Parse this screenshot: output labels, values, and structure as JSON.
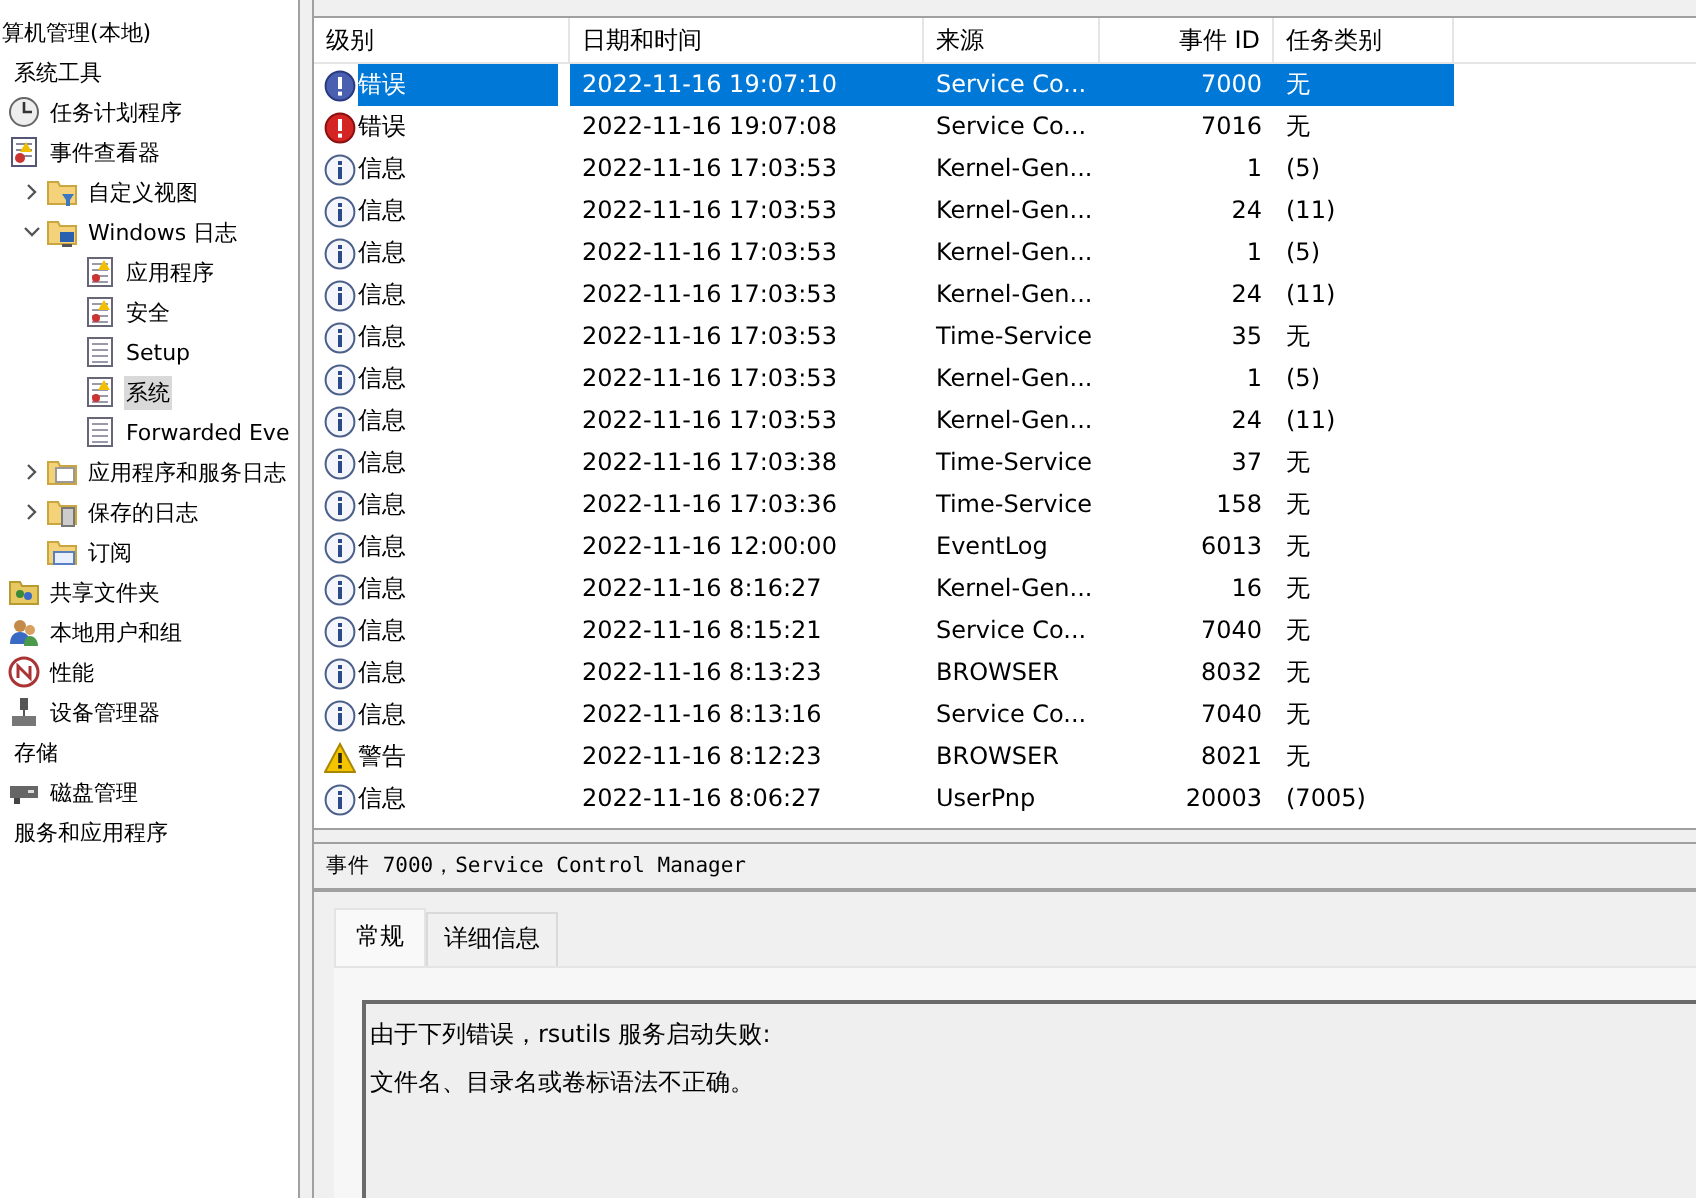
{
  "tree": {
    "label": "算机管理(本地)",
    "children": [
      {
        "label": "系统工具",
        "children": [
          {
            "label": "任务计划程序",
            "kind": "clock"
          },
          {
            "label": "事件查看器",
            "kind": "viewer",
            "children": [
              {
                "label": "自定义视图",
                "kind": "folder-filter",
                "expanded": false
              },
              {
                "label": "Windows 日志",
                "kind": "folder-pc",
                "expanded": true,
                "children": [
                  {
                    "label": "应用程序",
                    "kind": "log-alert",
                    "selected": false
                  },
                  {
                    "label": "安全",
                    "kind": "log-alert",
                    "selected": false
                  },
                  {
                    "label": "Setup",
                    "kind": "log",
                    "selected": false
                  },
                  {
                    "label": "系统",
                    "kind": "log-alert",
                    "selected": true
                  },
                  {
                    "label": "Forwarded Eve",
                    "kind": "log",
                    "selected": false
                  }
                ]
              },
              {
                "label": "应用程序和服务日志",
                "kind": "folder",
                "expanded": false
              },
              {
                "label": "保存的日志",
                "kind": "folder-log",
                "expanded": false
              },
              {
                "label": "订阅",
                "kind": "folder-sub"
              }
            ]
          },
          {
            "label": "共享文件夹",
            "kind": "share"
          },
          {
            "label": "本地用户和组",
            "kind": "users"
          },
          {
            "label": "性能",
            "kind": "perf"
          },
          {
            "label": "设备管理器",
            "kind": "device"
          }
        ]
      },
      {
        "label": "存储",
        "children": [
          {
            "label": "磁盘管理",
            "kind": "disk"
          }
        ]
      },
      {
        "label": "服务和应用程序"
      }
    ]
  },
  "table": {
    "columns": [
      "级别",
      "日期和时间",
      "来源",
      "事件 ID",
      "任务类别"
    ],
    "rows": [
      {
        "kind": "error",
        "level": "错误",
        "date": "2022-11-16 19:07:10",
        "source": "Service Co...",
        "id": "7000",
        "task": "无",
        "selected": true
      },
      {
        "kind": "error",
        "level": "错误",
        "date": "2022-11-16 19:07:08",
        "source": "Service Co...",
        "id": "7016",
        "task": "无",
        "selected": false
      },
      {
        "kind": "info",
        "level": "信息",
        "date": "2022-11-16 17:03:53",
        "source": "Kernel-Gen...",
        "id": "1",
        "task": "(5)",
        "selected": false
      },
      {
        "kind": "info",
        "level": "信息",
        "date": "2022-11-16 17:03:53",
        "source": "Kernel-Gen...",
        "id": "24",
        "task": "(11)",
        "selected": false
      },
      {
        "kind": "info",
        "level": "信息",
        "date": "2022-11-16 17:03:53",
        "source": "Kernel-Gen...",
        "id": "1",
        "task": "(5)",
        "selected": false
      },
      {
        "kind": "info",
        "level": "信息",
        "date": "2022-11-16 17:03:53",
        "source": "Kernel-Gen...",
        "id": "24",
        "task": "(11)",
        "selected": false
      },
      {
        "kind": "info",
        "level": "信息",
        "date": "2022-11-16 17:03:53",
        "source": "Time-Service",
        "id": "35",
        "task": "无",
        "selected": false
      },
      {
        "kind": "info",
        "level": "信息",
        "date": "2022-11-16 17:03:53",
        "source": "Kernel-Gen...",
        "id": "1",
        "task": "(5)",
        "selected": false
      },
      {
        "kind": "info",
        "level": "信息",
        "date": "2022-11-16 17:03:53",
        "source": "Kernel-Gen...",
        "id": "24",
        "task": "(11)",
        "selected": false
      },
      {
        "kind": "info",
        "level": "信息",
        "date": "2022-11-16 17:03:38",
        "source": "Time-Service",
        "id": "37",
        "task": "无",
        "selected": false
      },
      {
        "kind": "info",
        "level": "信息",
        "date": "2022-11-16 17:03:36",
        "source": "Time-Service",
        "id": "158",
        "task": "无",
        "selected": false
      },
      {
        "kind": "info",
        "level": "信息",
        "date": "2022-11-16 12:00:00",
        "source": "EventLog",
        "id": "6013",
        "task": "无",
        "selected": false
      },
      {
        "kind": "info",
        "level": "信息",
        "date": "2022-11-16 8:16:27",
        "source": "Kernel-Gen...",
        "id": "16",
        "task": "无",
        "selected": false
      },
      {
        "kind": "info",
        "level": "信息",
        "date": "2022-11-16 8:15:21",
        "source": "Service Co...",
        "id": "7040",
        "task": "无",
        "selected": false
      },
      {
        "kind": "info",
        "level": "信息",
        "date": "2022-11-16 8:13:23",
        "source": "BROWSER",
        "id": "8032",
        "task": "无",
        "selected": false
      },
      {
        "kind": "info",
        "level": "信息",
        "date": "2022-11-16 8:13:16",
        "source": "Service Co...",
        "id": "7040",
        "task": "无",
        "selected": false
      },
      {
        "kind": "warning",
        "level": "警告",
        "date": "2022-11-16 8:12:23",
        "source": "BROWSER",
        "id": "8021",
        "task": "无",
        "selected": false
      },
      {
        "kind": "info",
        "level": "信息",
        "date": "2022-11-16 8:06:27",
        "source": "UserPnp",
        "id": "20003",
        "task": "(7005)",
        "selected": false
      }
    ]
  },
  "detail": {
    "title": "事件 7000，Service Control Manager",
    "tabs": [
      {
        "label": "常规",
        "selected": true
      },
      {
        "label": "详细信息",
        "selected": false
      }
    ],
    "lines": [
      "由于下列错误，rsutils 服务启动失败:",
      "文件名、目录名或卷标语法不正确。"
    ]
  }
}
